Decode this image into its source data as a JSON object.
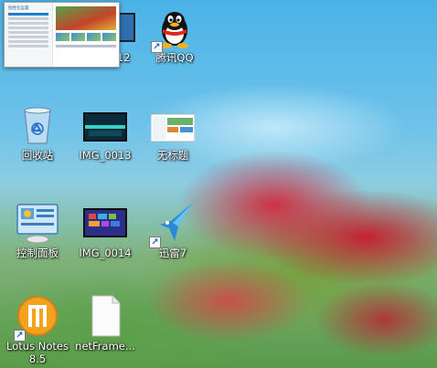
{
  "colors": {
    "sky": "#4ab3e6",
    "label_text": "#ffffff",
    "shortcut_arrow": "#1b63c6"
  },
  "preview_popup": {
    "title": "個性化設置"
  },
  "desktop_icons": [
    {
      "label": "",
      "partial_label": "...012",
      "icon": "picture-icon"
    },
    {
      "label": "腾讯QQ",
      "icon": "qq-penguin-icon",
      "shortcut": true
    },
    {
      "label": "回收站",
      "icon": "recycle-bin-icon"
    },
    {
      "label": "IMG_0013",
      "icon": "picture-icon"
    },
    {
      "label": "无标题",
      "icon": "document-thumbnail-icon"
    },
    {
      "label": "控制面板",
      "icon": "control-panel-icon"
    },
    {
      "label": "IMG_0014",
      "icon": "picture-icon"
    },
    {
      "label": "迅雷7",
      "icon": "xunlei-bird-icon",
      "shortcut": true
    },
    {
      "label": "Lotus Notes 8.5",
      "icon": "lotus-notes-icon",
      "shortcut": true
    },
    {
      "label": "netFrame...",
      "icon": "file-icon"
    }
  ]
}
